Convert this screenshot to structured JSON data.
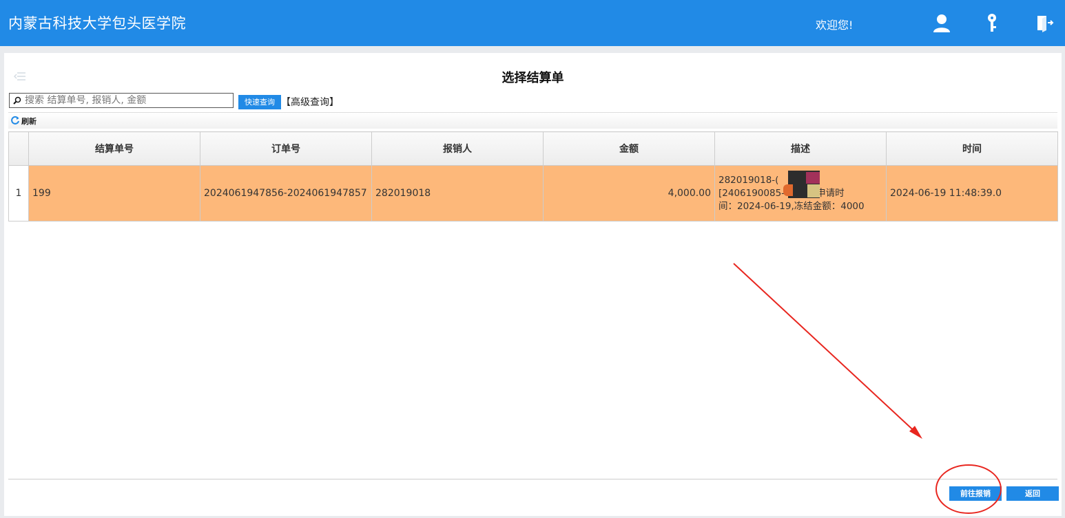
{
  "header": {
    "app_title": "内蒙古科技大学包头医学院",
    "welcome": "欢迎您!",
    "icons": [
      "user-icon",
      "key-icon",
      "logout-icon"
    ]
  },
  "page": {
    "title": "选择结算单"
  },
  "search": {
    "placeholder": "搜索 结算单号, 报销人, 金额",
    "value": "",
    "quick_label": "快速查询",
    "advanced_label": "【高级查询】"
  },
  "toolbar": {
    "refresh_label": "刷新"
  },
  "table": {
    "columns": [
      "结算单号",
      "订单号",
      "报销人",
      "金额",
      "描述",
      "时间"
    ],
    "rows": [
      {
        "row_number": "1",
        "settlement_no": "199",
        "order_no": "2024061947856-2024061947857",
        "claimant": "282019018",
        "amount": "4,000.00",
        "description_line1": "282019018-(",
        "description_line2": "[2406190085-",
        "description_line2_tail": "]-申请时",
        "description_line3": "间：2024-06-19,冻结金额：4000",
        "time": "2024-06-19 11:48:39.0"
      }
    ]
  },
  "footer": {
    "go_label": "前往报销",
    "back_label": "返回"
  },
  "colors": {
    "header_bg": "#218ae6",
    "selected_row": "#fdb87a",
    "annotation": "#e8261f"
  }
}
